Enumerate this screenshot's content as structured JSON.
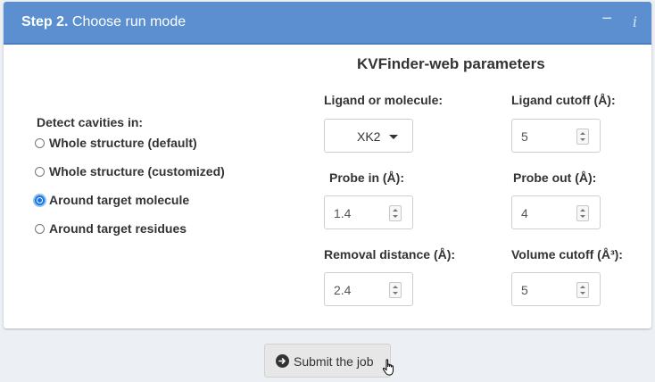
{
  "header": {
    "step": "Step 2.",
    "title": "Choose run mode",
    "minimize_glyph": "−",
    "info_glyph": "i"
  },
  "detect": {
    "label": "Detect cavities in:",
    "options": [
      {
        "label": "Whole structure (default)",
        "checked": false
      },
      {
        "label": "Whole structure (customized)",
        "checked": false
      },
      {
        "label": "Around target molecule",
        "checked": true
      },
      {
        "label": "Around target residues",
        "checked": false
      }
    ]
  },
  "params": {
    "title": "KVFinder-web parameters",
    "ligand_label": "Ligand or molecule:",
    "ligand_value": "XK2",
    "ligand_cutoff_label": "Ligand cutoff (Å):",
    "ligand_cutoff_value": "5",
    "probe_in_label": "Probe in (Å):",
    "probe_in_value": "1.4",
    "probe_out_label": "Probe out (Å):",
    "probe_out_value": "4",
    "removal_label": "Removal distance (Å):",
    "removal_value": "2.4",
    "volume_label": "Volume cutoff (Å³):",
    "volume_value": "5"
  },
  "submit": {
    "label": "Submit the job",
    "icon": "arrow-circle-right-icon"
  },
  "colors": {
    "header_bg": "#5b8fcf",
    "page_bg": "#ecf0f5",
    "radio_accent": "#1a73e8"
  }
}
